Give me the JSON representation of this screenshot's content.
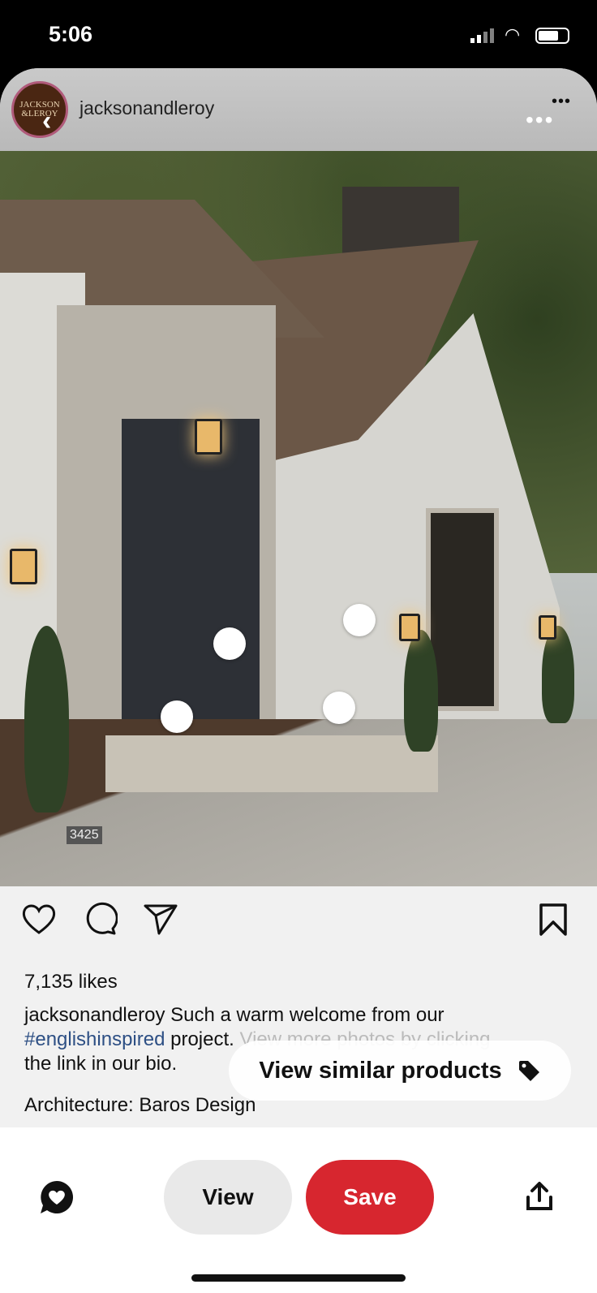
{
  "status": {
    "time": "5:06"
  },
  "post": {
    "avatar_text": "JACKSON & LEROY",
    "username": "jacksonandleroy",
    "house_number": "3425",
    "likes": "7,135 likes",
    "caption": {
      "user": "jacksonandleroy",
      "text1": " Such a warm welcome from our",
      "hashtag": "#englishinspired",
      "text2": " project.",
      "text3": " View more photos by clicking",
      "text4": "the link in our bio."
    },
    "credit": "Architecture: Baros Design"
  },
  "similar_label": "View similar products",
  "bottom": {
    "view": "View",
    "save": "Save"
  },
  "colors": {
    "save": "#d7262f",
    "hashtag": "#2d4f84"
  }
}
